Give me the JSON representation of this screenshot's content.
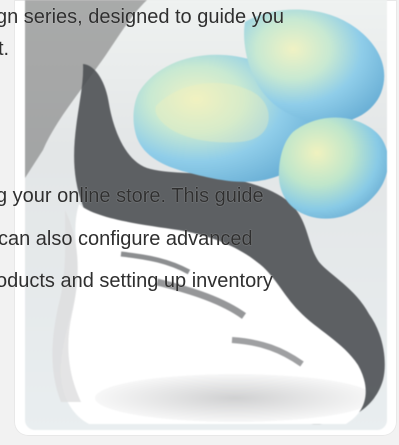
{
  "content": {
    "lines": [
      "gn series, designed to guide you",
      "t.",
      "g your online store. This guide",
      " can also configure advanced",
      "oducts and setting up inventory"
    ]
  }
}
